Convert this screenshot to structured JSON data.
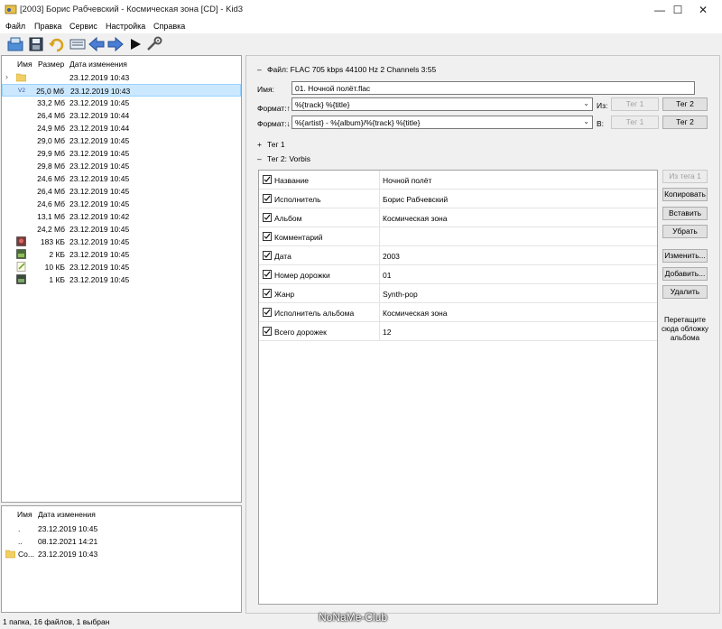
{
  "window": {
    "title": "[2003] Борис Рабчевский - Космическая зона [CD] - Kid3",
    "minimize": "—",
    "maximize": "☐",
    "close": "✕"
  },
  "menu": [
    "Файл",
    "Правка",
    "Сервис",
    "Настройка",
    "Справка"
  ],
  "toolbar": [
    "open-icon",
    "save-icon",
    "revert-icon",
    "playlist-icon",
    "previous-icon",
    "next-icon",
    "play-icon",
    "settings-icon"
  ],
  "file_list": {
    "headers": {
      "name": "Имя",
      "size": "Размер",
      "date": "Дата изменения"
    },
    "rows": [
      {
        "icon": "folder",
        "size": "",
        "date": "23.12.2019 10:43"
      },
      {
        "icon": "v2",
        "size": "25,0 Мб",
        "date": "23.12.2019 10:43"
      },
      {
        "icon": "",
        "size": "33,2 Мб",
        "date": "23.12.2019 10:45"
      },
      {
        "icon": "",
        "size": "26,4 Мб",
        "date": "23.12.2019 10:44"
      },
      {
        "icon": "",
        "size": "24,9 Мб",
        "date": "23.12.2019 10:44"
      },
      {
        "icon": "",
        "size": "29,0 Мб",
        "date": "23.12.2019 10:45"
      },
      {
        "icon": "",
        "size": "29,9 Мб",
        "date": "23.12.2019 10:45"
      },
      {
        "icon": "",
        "size": "29,8 Мб",
        "date": "23.12.2019 10:45"
      },
      {
        "icon": "",
        "size": "24,6 Мб",
        "date": "23.12.2019 10:45"
      },
      {
        "icon": "",
        "size": "26,4 Мб",
        "date": "23.12.2019 10:45"
      },
      {
        "icon": "",
        "size": "24,6 Мб",
        "date": "23.12.2019 10:45"
      },
      {
        "icon": "",
        "size": "13,1 Мб",
        "date": "23.12.2019 10:42"
      },
      {
        "icon": "",
        "size": "24,2 Мб",
        "date": "23.12.2019 10:45"
      },
      {
        "icon": "image",
        "size": "183 КБ",
        "date": "23.12.2019 10:45"
      },
      {
        "icon": "image",
        "size": "2 КБ",
        "date": "23.12.2019 10:45"
      },
      {
        "icon": "text",
        "size": "10 КБ",
        "date": "23.12.2019 10:45"
      },
      {
        "icon": "image",
        "size": "1 КБ",
        "date": "23.12.2019 10:45"
      }
    ],
    "selected_badge": "V2"
  },
  "dir_list": {
    "headers": {
      "name": "Имя",
      "date": "Дата изменения"
    },
    "rows": [
      {
        "name": ".",
        "date": "23.12.2019 10:45"
      },
      {
        "name": "..",
        "date": "08.12.2021 14:21"
      },
      {
        "name": "Co...",
        "date": "23.12.2019 10:43"
      }
    ]
  },
  "file_info": "Файл: FLAC 705 kbps 44100 Hz 2 Channels 3:55",
  "name_label": "Имя:",
  "name_value": "01. Ночной полёт.flac",
  "format_up_label": "Формат:↑",
  "format_up_value": "%{track} %{title}",
  "format_down_label": "Формат:↓",
  "format_down_value": "%{artist} - %{album}/%{track} %{title}",
  "from_label": "Из:",
  "to_label": "В:",
  "tag1_btn": "Тег 1",
  "tag2_btn": "Тег 2",
  "tag1_section": "Тег 1",
  "tag2_section": "Тег 2: Vorbis",
  "tag_fields": [
    {
      "name": "Название",
      "value": "Ночной полёт"
    },
    {
      "name": "Исполнитель",
      "value": "Борис Рабчевский"
    },
    {
      "name": "Альбом",
      "value": "Космическая зона"
    },
    {
      "name": "Комментарий",
      "value": ""
    },
    {
      "name": "Дата",
      "value": "2003"
    },
    {
      "name": "Номер дорожки",
      "value": "01"
    },
    {
      "name": "Жанр",
      "value": "Synth-pop"
    },
    {
      "name": "Исполнитель альбома",
      "value": "Космическая зона"
    },
    {
      "name": "Всего дорожек",
      "value": "12"
    }
  ],
  "side_buttons": {
    "from_tag1": "Из тега 1",
    "copy": "Копировать",
    "paste": "Вставить",
    "remove": "Убрать",
    "edit": "Изменить...",
    "add": "Добавить...",
    "delete": "Удалить"
  },
  "cover_hint": "Перетащите сюда обложку альбома",
  "status": "1 папка, 16 файлов, 1 выбран",
  "watermark": "NoNaMe-Club"
}
